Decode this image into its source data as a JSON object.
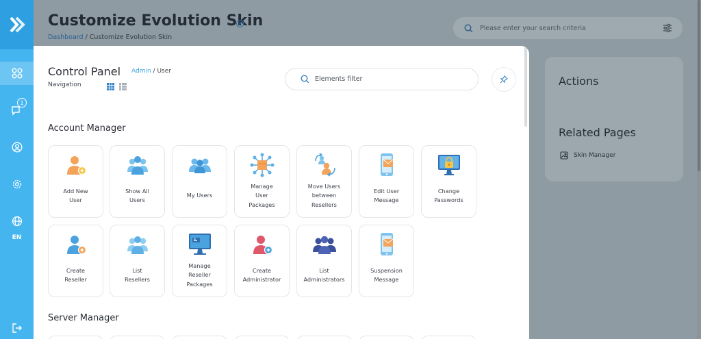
{
  "colors": {
    "accent": "#45b5f0",
    "link": "#3aa4e4",
    "orange": "#f3a35a",
    "blue": "#4aa3df"
  },
  "sidebar": {
    "items": [
      {
        "name": "apps",
        "icon": "apps-grid-icon",
        "active": true
      },
      {
        "name": "messages",
        "icon": "chat-icon",
        "badge": "1"
      },
      {
        "name": "account",
        "icon": "user-circle-icon"
      },
      {
        "name": "settings",
        "icon": "gear-icon"
      },
      {
        "name": "language",
        "icon": "globe-icon",
        "label": "EN"
      },
      {
        "name": "logout",
        "icon": "logout-icon"
      }
    ]
  },
  "page": {
    "title": "Customize Evolution Skin",
    "breadcrumb": {
      "root": "Dashboard",
      "separator": " / ",
      "current": "Customize Evolution Skin"
    },
    "search_placeholder": "Please enter your search criteria",
    "actions_title": "Actions",
    "related_title": "Related Pages",
    "related_items": [
      "Skin Manager"
    ]
  },
  "panel": {
    "title": "Control Panel",
    "breadcrumb_link": "Admin",
    "breadcrumb_separator": " / ",
    "breadcrumb_current": "User",
    "navigation_label": "Navigation",
    "filter_placeholder": "Elements filter",
    "sections": [
      {
        "title": "Account Manager",
        "tiles": [
          {
            "label": "Add New\nUser",
            "icon": "add-user-icon"
          },
          {
            "label": "Show All\nUsers",
            "icon": "users-group-icon"
          },
          {
            "label": "My Users",
            "icon": "my-users-icon"
          },
          {
            "label": "Manage\nUser\nPackages",
            "icon": "package-network-icon"
          },
          {
            "label": "Move Users\nbetween\nResellers",
            "icon": "move-users-icon"
          },
          {
            "label": "Edit User\nMessage",
            "icon": "phone-message-icon"
          },
          {
            "label": "Change\nPasswords",
            "icon": "monitor-lock-icon"
          },
          {
            "label": "Create\nReseller",
            "icon": "add-reseller-icon"
          },
          {
            "label": "List\nResellers",
            "icon": "resellers-group-icon"
          },
          {
            "label": "Manage\nReseller\nPackages",
            "icon": "monitor-package-icon"
          },
          {
            "label": "Create\nAdministrator",
            "icon": "add-admin-icon"
          },
          {
            "label": "List\nAdministrators",
            "icon": "admins-group-icon"
          },
          {
            "label": "Suspension\nMessage",
            "icon": "phone-suspension-icon"
          }
        ]
      },
      {
        "title": "Server Manager",
        "tiles": []
      }
    ]
  }
}
